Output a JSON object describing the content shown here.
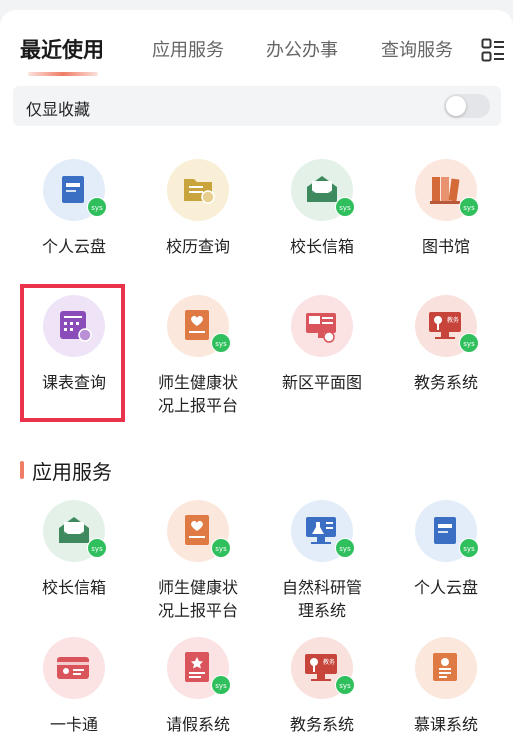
{
  "tabs": [
    "最近使用",
    "应用服务",
    "办公办事",
    "查询服务"
  ],
  "favorites_only": {
    "label": "仅显收藏",
    "enabled": false
  },
  "recent_apps": [
    {
      "label": "个人云盘",
      "icon": "cloud-drive-icon",
      "color": "#3a6fc4",
      "bg": "#e3ecf9",
      "sys": true
    },
    {
      "label": "校历查询",
      "icon": "folder-calendar-icon",
      "color": "#c9a33c",
      "bg": "#f8efd6",
      "sys": false
    },
    {
      "label": "校长信箱",
      "icon": "public-mail-icon",
      "color": "#3e8a5e",
      "bg": "#e3f1e8",
      "sys": true
    },
    {
      "label": "图书馆",
      "icon": "books-icon",
      "color": "#d46a3a",
      "bg": "#fbe7de",
      "sys": true
    },
    {
      "label": "课表查询",
      "icon": "timetable-icon",
      "color": "#8a4cb8",
      "bg": "#efe4f7",
      "sys": false
    },
    {
      "label": "师生健康状况上报平台",
      "label_lines": [
        "师生健康状",
        "况上报平台"
      ],
      "icon": "health-report-icon",
      "color": "#e07a45",
      "bg": "#fbe7dc",
      "sys": true
    },
    {
      "label": "新区平面图",
      "icon": "map-screen-icon",
      "color": "#d9555b",
      "bg": "#fbe2e3",
      "sys": false
    },
    {
      "label": "教务系统",
      "icon": "academic-affairs-icon",
      "color": "#c6443a",
      "bg": "#f9e1de",
      "sys": true
    }
  ],
  "section": {
    "title": "应用服务"
  },
  "service_apps": [
    {
      "label": "校长信箱",
      "icon": "public-mail-icon",
      "color": "#3e8a5e",
      "bg": "#e3f1e8",
      "sys": true
    },
    {
      "label": "师生健康状况上报平台",
      "label_lines": [
        "师生健康状",
        "况上报平台"
      ],
      "icon": "health-report-icon",
      "color": "#e07a45",
      "bg": "#fbe7dc",
      "sys": true
    },
    {
      "label": "自然科研管理系统",
      "label_lines": [
        "自然科研管",
        "理系统"
      ],
      "icon": "science-lab-icon",
      "color": "#3a6fc4",
      "bg": "#e3ecf9",
      "sys": true
    },
    {
      "label": "个人云盘",
      "icon": "cloud-drive-icon",
      "color": "#3a6fc4",
      "bg": "#e3ecf9",
      "sys": true
    },
    {
      "label": "一卡通",
      "icon": "id-card-icon",
      "color": "#d9555b",
      "bg": "#fbe2e3",
      "sys": false
    },
    {
      "label": "请假系统",
      "icon": "leave-request-icon",
      "color": "#d9555b",
      "bg": "#fbe2e3",
      "sys": true
    },
    {
      "label": "教务系统",
      "icon": "academic-affairs-icon",
      "color": "#c6443a",
      "bg": "#f9e1de",
      "sys": true
    },
    {
      "label": "慕课系统",
      "icon": "mooc-icon",
      "color": "#e07a45",
      "bg": "#fbe7dc",
      "sys": false
    }
  ],
  "sys_badge": "sys",
  "colors": {
    "accent": "#ef7d66",
    "highlight": "#e8334a",
    "sys_badge": "#2fbf5c"
  }
}
